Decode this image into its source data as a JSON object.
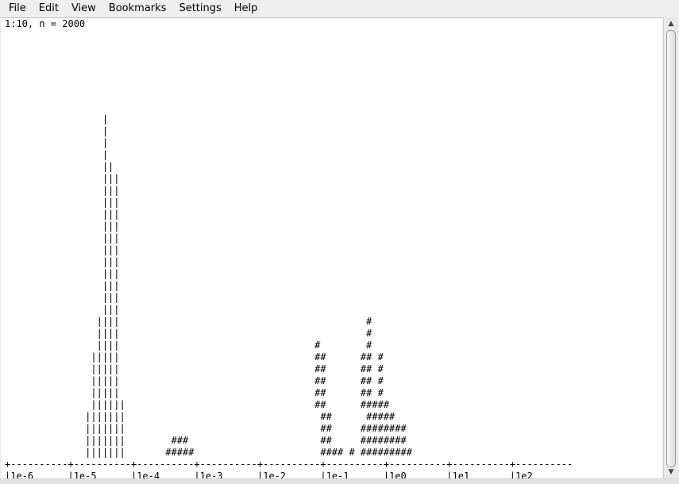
{
  "menu": [
    "File",
    "Edit",
    "View",
    "Bookmarks",
    "Settings",
    "Help"
  ],
  "terminal": {
    "lines": [
      "1:10, n = 2000",
      "",
      "",
      "",
      "",
      "",
      "",
      "",
      "                 |",
      "                 |",
      "                 |",
      "                 |",
      "                 ||",
      "                 |||",
      "                 |||",
      "                 |||",
      "                 |||",
      "                 |||",
      "                 |||",
      "                 |||",
      "                 |||",
      "                 |||",
      "                 |||",
      "                 |||",
      "                 |||",
      "                ||||                                           #",
      "                ||||                                           #",
      "                ||||                                  #        #",
      "               |||||                                  ##      ## #",
      "               |||||                                  ##      ## #",
      "               |||||                                  ##      ## #",
      "               |||||                                  ##      ## #",
      "               ||||||                                 ##      #####",
      "              |||||||                                  ##      #####",
      "              |||||||                                  ##     ########",
      "              |||||||        ###                       ##     ########",
      "              |||||||       #####                      #### # #########",
      "+----------+----------+----------+----------+----------+----------+----------+----------+----------",
      "|1e-6      |1e-5      |1e-4      |1e-3      |1e-2      |1e-1      |1e0       |1e1       |1e2"
    ]
  }
}
